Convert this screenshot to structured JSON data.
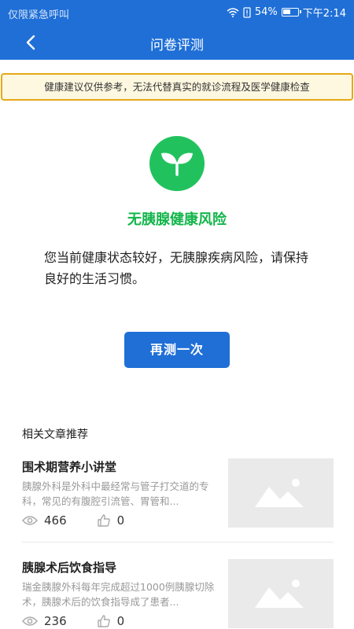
{
  "status_bar": {
    "carrier": "仅限紧急呼叫",
    "battery": "54%",
    "battery_level": 0.54,
    "time": "下午2:14"
  },
  "nav": {
    "title": "问卷评测"
  },
  "notice": {
    "text": "健康建议仅供参考，无法代替真实的就诊流程及医学健康检查"
  },
  "result": {
    "title": "无胰腺健康风险",
    "description": "您当前健康状态较好，无胰腺疾病风险，请保持良好的生活习惯。",
    "retry_label": "再测一次"
  },
  "articles_section": {
    "title": "相关文章推荐",
    "items": [
      {
        "title": "围术期营养小讲堂",
        "excerpt": "胰腺外科是外科中最经常与管子打交道的专科，常见的有腹腔引流管、胃管和...",
        "views": "466",
        "likes": "0"
      },
      {
        "title": "胰腺术后饮食指导",
        "excerpt": "瑞金胰腺外科每年完成超过1000例胰腺切除术，胰腺术后的饮食指导成了患者...",
        "views": "236",
        "likes": "0"
      }
    ]
  },
  "colors": {
    "primary": "#1f6fd7",
    "success": "#12b54a",
    "notice_border": "#e6a817"
  }
}
